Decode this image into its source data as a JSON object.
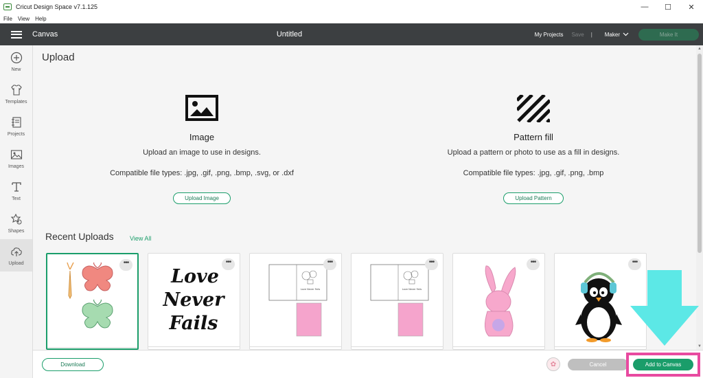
{
  "window": {
    "title": "Cricut Design Space  v7.1.125",
    "controls": {
      "minimize": "—",
      "maximize": "☐",
      "close": "✕"
    }
  },
  "menu": {
    "items": [
      "File",
      "View",
      "Help"
    ]
  },
  "header": {
    "section": "Canvas",
    "doc_title": "Untitled",
    "my_projects": "My Projects",
    "save": "Save",
    "separator": "|",
    "machine": "Maker",
    "make_it": "Make It"
  },
  "sidebar": {
    "items": [
      {
        "label": "New",
        "icon": "plus-circle-icon"
      },
      {
        "label": "Templates",
        "icon": "tshirt-icon"
      },
      {
        "label": "Projects",
        "icon": "notebook-icon"
      },
      {
        "label": "Images",
        "icon": "image-icon"
      },
      {
        "label": "Text",
        "icon": "text-t-icon"
      },
      {
        "label": "Shapes",
        "icon": "shapes-icon"
      },
      {
        "label": "Upload",
        "icon": "cloud-upload-icon"
      }
    ],
    "active": "Upload"
  },
  "main": {
    "title": "Upload",
    "image_section": {
      "title": "Image",
      "description": "Upload an image to use in designs.",
      "types": "Compatible file types: .jpg, .gif, .png, .bmp, .svg, or .dxf",
      "button": "Upload Image"
    },
    "pattern_section": {
      "title": "Pattern fill",
      "description": "Upload a pattern or photo to use as a fill in designs.",
      "types": "Compatible file types: .jpg, .gif, .png, .bmp",
      "button": "Upload Pattern"
    },
    "recent": {
      "title": "Recent Uploads",
      "view_all": "View All",
      "items": [
        {
          "name": "butterflies",
          "selected": true
        },
        {
          "name": "love-never-fails",
          "text_lines": [
            "Love",
            "Never",
            "Fails"
          ]
        },
        {
          "name": "card-template-1",
          "tiny_text": "Love Never Fails"
        },
        {
          "name": "card-template-2",
          "tiny_text": "Love Never Fails"
        },
        {
          "name": "pink-bunny"
        },
        {
          "name": "penguin-headphones"
        }
      ],
      "menu_glyph": "•••"
    }
  },
  "footer": {
    "download": "Download",
    "cancel": "Cancel",
    "add_to_canvas": "Add to Canvas"
  },
  "colors": {
    "accent": "#1a9d6a",
    "header_bg": "#3c3f41",
    "highlight": "#e84aa0",
    "arrow": "#5ce8e6"
  }
}
